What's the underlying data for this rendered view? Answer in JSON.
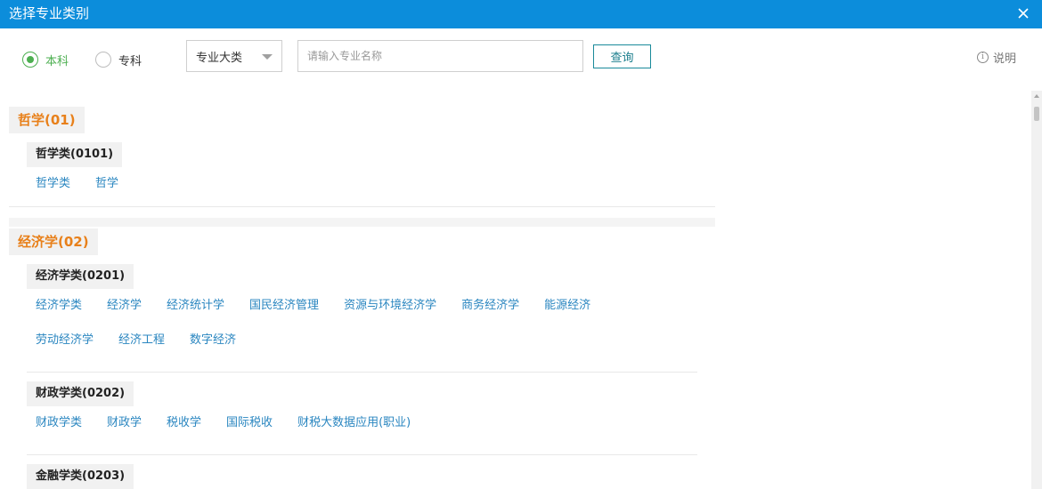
{
  "window": {
    "title": "选择专业类别"
  },
  "filters": {
    "degree_options": [
      {
        "label": "本科",
        "checked": true
      },
      {
        "label": "专科",
        "checked": false
      }
    ],
    "level_select": {
      "value": "专业大类"
    },
    "search": {
      "placeholder": "请输入专业名称",
      "value": ""
    },
    "query_label": "查询",
    "help_label": "说明"
  },
  "categories": [
    {
      "name": "哲学(01)",
      "subcategories": [
        {
          "name": "哲学类(0101)",
          "majors": [
            "哲学类",
            "哲学"
          ]
        }
      ]
    },
    {
      "name": "经济学(02)",
      "subcategories": [
        {
          "name": "经济学类(0201)",
          "majors": [
            "经济学类",
            "经济学",
            "经济统计学",
            "国民经济管理",
            "资源与环境经济学",
            "商务经济学",
            "能源经济",
            "劳动经济学",
            "经济工程",
            "数字经济"
          ]
        },
        {
          "name": "财政学类(0202)",
          "majors": [
            "财政学类",
            "财政学",
            "税收学",
            "国际税收",
            "财税大数据应用(职业)"
          ]
        },
        {
          "name": "金融学类(0203)",
          "majors": []
        }
      ]
    }
  ],
  "theme": {
    "titlebar_color": "#0c8ddb",
    "category_color": "#e8801a",
    "major_link_color": "#2a86c0",
    "radio_checked_color": "#4caf50"
  }
}
